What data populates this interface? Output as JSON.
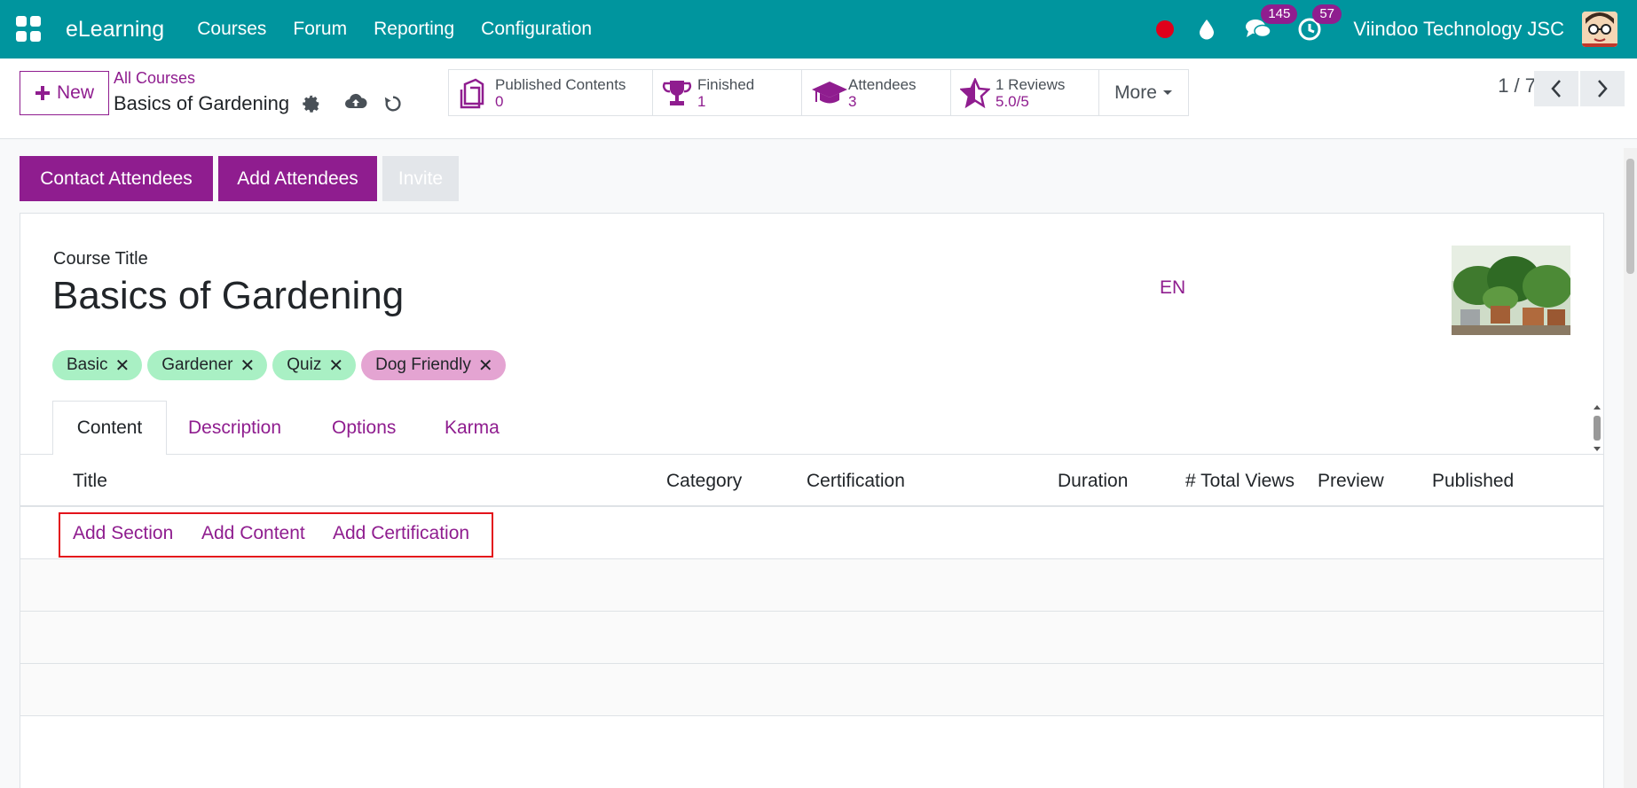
{
  "navbar": {
    "brand": "eLearning",
    "menu": [
      "Courses",
      "Forum",
      "Reporting",
      "Configuration"
    ],
    "messages_count": "145",
    "activities_count": "57",
    "company": "Viindoo Technology JSC"
  },
  "control": {
    "new_label": "New",
    "breadcrumb": "All Courses",
    "record_title": "Basics of Gardening",
    "stats": [
      {
        "label": "Published Contents",
        "value": "0"
      },
      {
        "label": "Finished",
        "value": "1"
      },
      {
        "label": "Attendees",
        "value": "3"
      },
      {
        "label": "1 Reviews",
        "value": "5.0/5"
      }
    ],
    "more_label": "More",
    "pager": "1 / 7"
  },
  "actions": {
    "contact": "Contact Attendees",
    "add": "Add Attendees",
    "invite": "Invite"
  },
  "form": {
    "title_label": "Course Title",
    "title_value": "Basics of Gardening",
    "lang": "EN",
    "tags": [
      "Basic",
      "Gardener",
      "Quiz",
      "Dog Friendly"
    ],
    "tabs": [
      "Content",
      "Description",
      "Options",
      "Karma"
    ],
    "columns": [
      "Title",
      "Category",
      "Certification",
      "Duration",
      "# Total Views",
      "Preview",
      "Published"
    ],
    "add_links": [
      "Add Section",
      "Add Content",
      "Add Certification"
    ]
  },
  "colors": {
    "navbar": "#00959e",
    "primary": "#8f1d8f",
    "tag_green": "#a9f0c4",
    "tag_pink": "#e4a4d2",
    "highlight": "#e3131b"
  }
}
